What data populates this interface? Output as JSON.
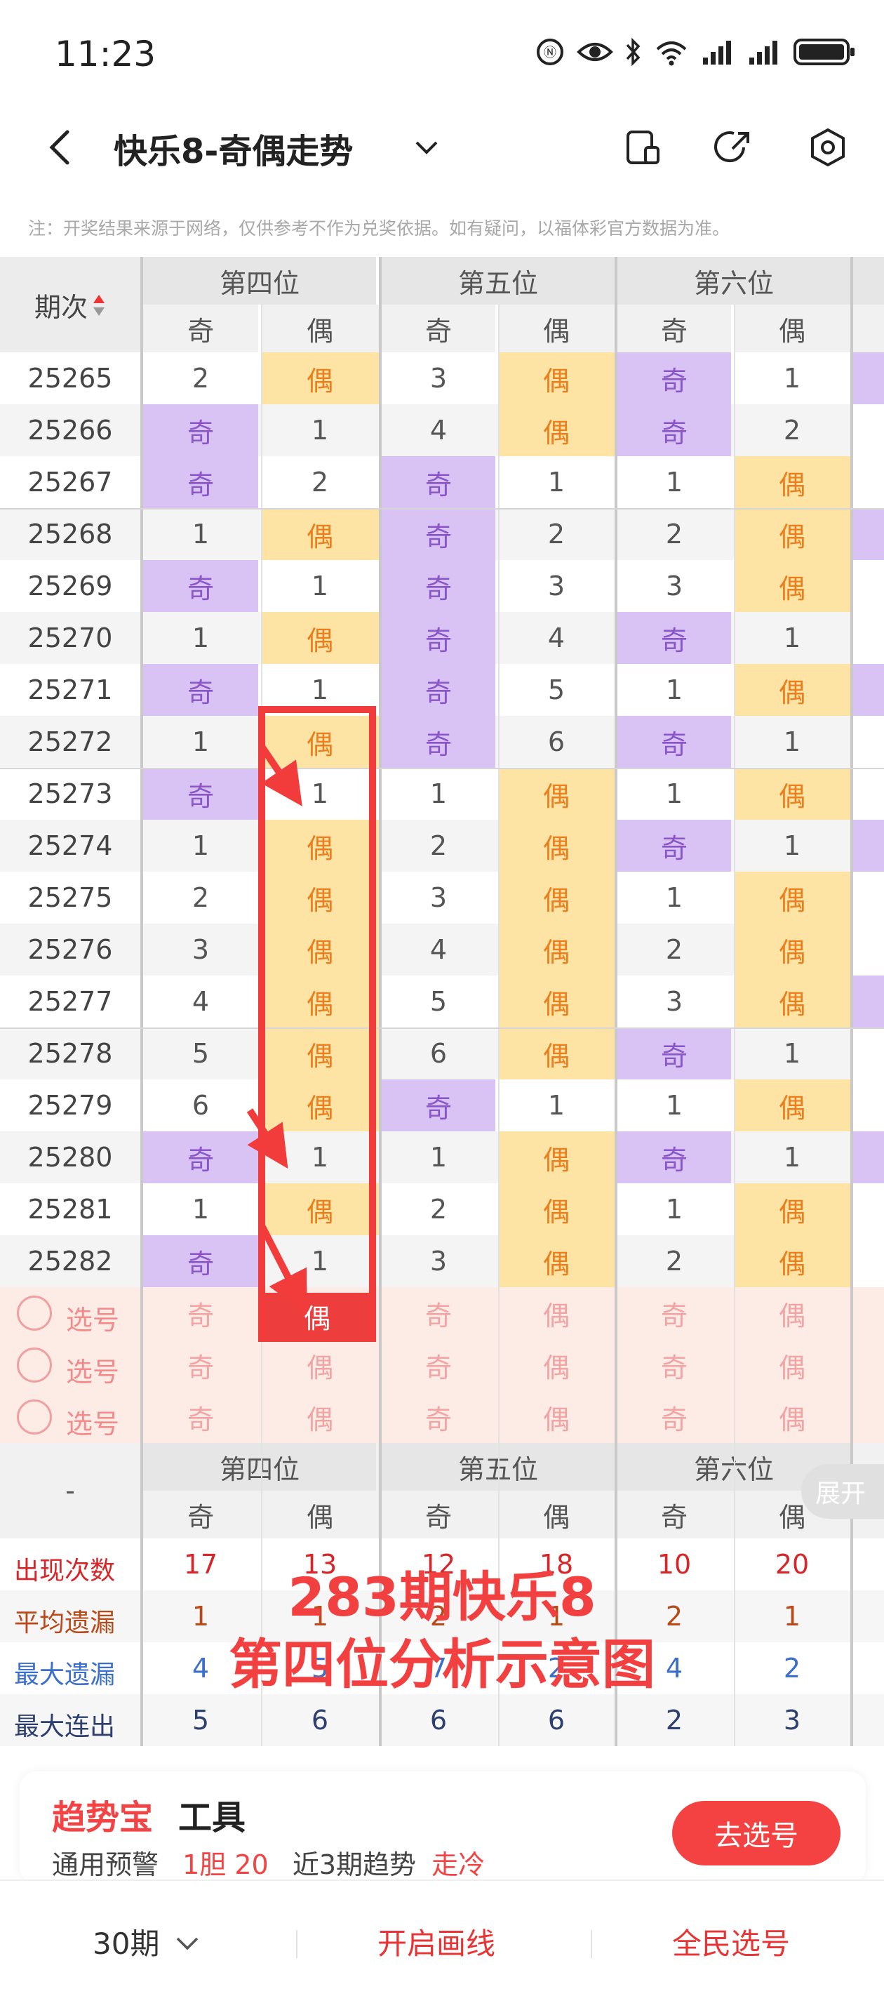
{
  "status_bar": {
    "time": "11:23",
    "icons": [
      "alarm-icon",
      "eye-icon",
      "bluetooth-icon",
      "wifi-icon",
      "signal-icon",
      "signal-icon",
      "battery-icon"
    ]
  },
  "nav": {
    "title": "快乐8-奇偶走势",
    "icons": [
      "back-icon",
      "chevron-down-icon",
      "device-icon",
      "share-icon",
      "settings-icon"
    ]
  },
  "notice": "注：开奖结果来源于网络，仅供参考不作为兑奖依据。如有疑问，以福体彩官方数据为准。",
  "table": {
    "period_header": "期次",
    "groups": [
      "第四位",
      "第五位",
      "第六位"
    ],
    "sub_headers": [
      "奇",
      "偶",
      "奇",
      "偶",
      "奇",
      "偶"
    ],
    "odd_text": "奇",
    "even_text": "偶",
    "rows": [
      {
        "period": "25265",
        "cells": [
          "2",
          "E",
          "3",
          "E",
          "O",
          "1"
        ]
      },
      {
        "period": "25266",
        "cells": [
          "O",
          "1",
          "4",
          "E",
          "O",
          "2"
        ]
      },
      {
        "period": "25267",
        "cells": [
          "O",
          "2",
          "O",
          "1",
          "1",
          "E"
        ]
      },
      {
        "period": "25268",
        "cells": [
          "1",
          "E",
          "O",
          "2",
          "2",
          "E"
        ]
      },
      {
        "period": "25269",
        "cells": [
          "O",
          "1",
          "O",
          "3",
          "3",
          "E"
        ]
      },
      {
        "period": "25270",
        "cells": [
          "1",
          "E",
          "O",
          "4",
          "O",
          "1"
        ]
      },
      {
        "period": "25271",
        "cells": [
          "O",
          "1",
          "O",
          "5",
          "1",
          "E"
        ]
      },
      {
        "period": "25272",
        "cells": [
          "1",
          "E",
          "O",
          "6",
          "O",
          "1"
        ]
      },
      {
        "period": "25273",
        "cells": [
          "O",
          "1",
          "1",
          "E",
          "1",
          "E"
        ]
      },
      {
        "period": "25274",
        "cells": [
          "1",
          "E",
          "2",
          "E",
          "O",
          "1"
        ]
      },
      {
        "period": "25275",
        "cells": [
          "2",
          "E",
          "3",
          "E",
          "1",
          "E"
        ]
      },
      {
        "period": "25276",
        "cells": [
          "3",
          "E",
          "4",
          "E",
          "2",
          "E"
        ]
      },
      {
        "period": "25277",
        "cells": [
          "4",
          "E",
          "5",
          "E",
          "3",
          "E"
        ]
      },
      {
        "period": "25278",
        "cells": [
          "5",
          "E",
          "6",
          "E",
          "O",
          "1"
        ]
      },
      {
        "period": "25279",
        "cells": [
          "6",
          "E",
          "O",
          "1",
          "1",
          "E"
        ]
      },
      {
        "period": "25280",
        "cells": [
          "O",
          "1",
          "1",
          "E",
          "O",
          "1"
        ]
      },
      {
        "period": "25281",
        "cells": [
          "1",
          "E",
          "2",
          "E",
          "1",
          "E"
        ]
      },
      {
        "period": "25282",
        "cells": [
          "O",
          "1",
          "3",
          "E",
          "2",
          "E"
        ]
      }
    ],
    "pick_label": "选号",
    "pick_rows": [
      [
        "奇",
        "偶",
        "奇",
        "偶",
        "奇",
        "偶"
      ],
      [
        "奇",
        "偶",
        "奇",
        "偶",
        "奇",
        "偶"
      ],
      [
        "奇",
        "偶",
        "奇",
        "偶",
        "奇",
        "偶"
      ]
    ],
    "highlighted_pick": "偶",
    "footer_dash": "-",
    "expand_label": "展开",
    "stats": [
      {
        "label": "出现次数",
        "color": "#d6262a",
        "vcolor": "#d6262a",
        "values": [
          "17",
          "13",
          "12",
          "18",
          "10",
          "20"
        ]
      },
      {
        "label": "平均遗漏",
        "color": "#b84a1a",
        "vcolor": "#b84a1a",
        "values": [
          "1",
          "1",
          "2",
          "1",
          "2",
          "1"
        ]
      },
      {
        "label": "最大遗漏",
        "color": "#3a6fcc",
        "vcolor": "#3a6fcc",
        "values": [
          "4",
          "5",
          "7",
          "2",
          "4",
          "2"
        ]
      },
      {
        "label": "最大连出",
        "color": "#2c3f6e",
        "vcolor": "#2c3f6e",
        "values": [
          "5",
          "6",
          "6",
          "6",
          "2",
          "3"
        ]
      }
    ]
  },
  "overlay": {
    "line1": "283期快乐8",
    "line2": "第四位分析示意图"
  },
  "tool_card": {
    "brand": "趋势宝",
    "word": "工具",
    "warn_label": "通用预警",
    "warn_value": "1胆 20",
    "trend_label": "近3期趋势",
    "trend_value": "走冷",
    "button": "去选号"
  },
  "bottom_bar": {
    "periods": "30期",
    "draw_lines": "开启画线",
    "pick": "全民选号"
  }
}
